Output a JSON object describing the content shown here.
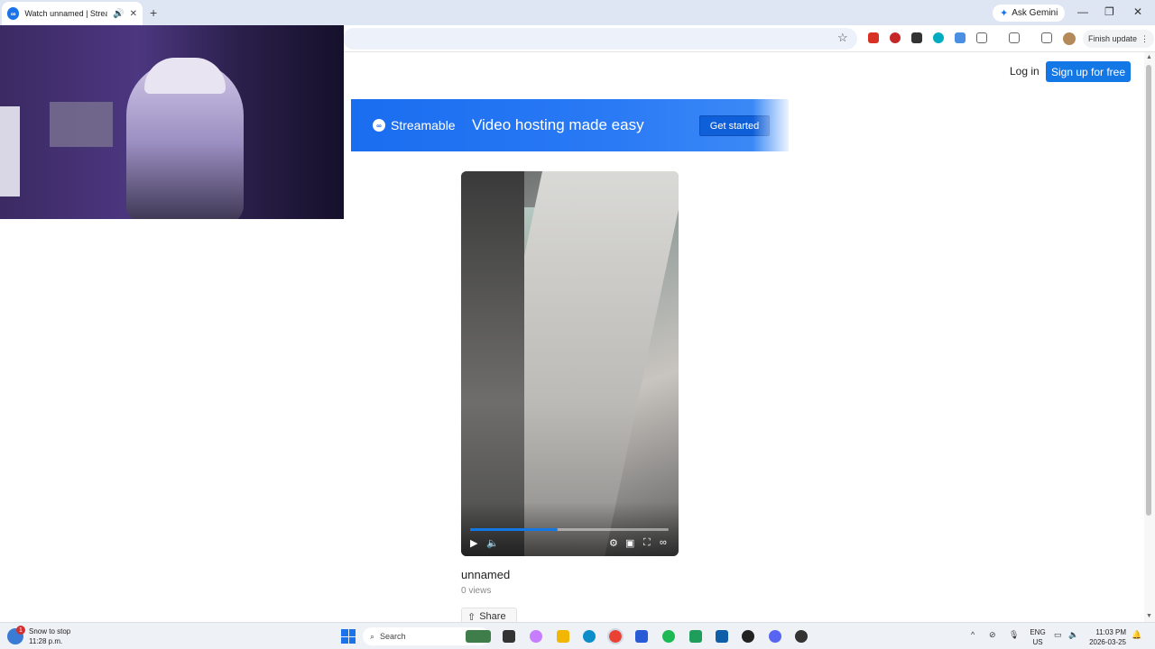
{
  "browser": {
    "tab_title": "Watch unnamed | Streamable",
    "tab_favicon": "streamable-icon",
    "new_tab": "+",
    "ask_gemini": "Ask Gemini",
    "finish_update": "Finish update",
    "window_controls": {
      "minimize": "—",
      "restore": "❐",
      "close": "✕"
    }
  },
  "header": {
    "login": "Log in",
    "signup": "Sign up for free"
  },
  "banner": {
    "brand": "Streamable",
    "tagline": "Video hosting made easy",
    "cta": "Get started",
    "color": "#1a6df0"
  },
  "video": {
    "title": "unnamed",
    "views": "0 views",
    "share": "Share",
    "progress_fraction": 0.44,
    "accent": "#1477e6",
    "controls": [
      "play-icon",
      "volume-icon",
      "settings-icon",
      "picture-in-picture-icon",
      "fullscreen-icon",
      "streamable-logo-icon"
    ]
  },
  "taskbar": {
    "weather_line1": "Snow to stop",
    "weather_line2": "11:28 p.m.",
    "weather_badge": "1",
    "search": "Search",
    "lang_line1": "ENG",
    "lang_line2": "US",
    "time": "11:03 PM",
    "date": "2026-03-25"
  }
}
